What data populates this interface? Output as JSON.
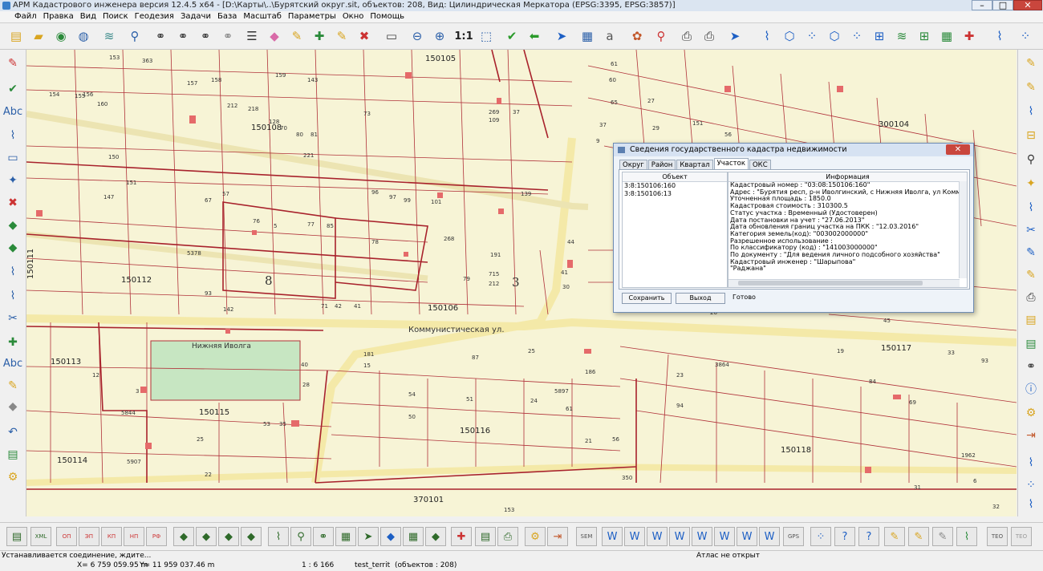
{
  "window": {
    "title": "АРМ Кадастрового инженера версия 12.4.5 x64 - [D:\\Карты\\..\\Бурятский округ.sit, объектов: 208, Вид: Цилиндрическая Меркатора (EPSG:3395, EPSG:3857)]",
    "minimize": "–",
    "maximize": "□",
    "close": "✕"
  },
  "menu": [
    "Файл",
    "Правка",
    "Вид",
    "Поиск",
    "Геодезия",
    "Задачи",
    "База",
    "Масштаб",
    "Параметры",
    "Окно",
    "Помощь"
  ],
  "toolbar": {
    "scale_label": "1:1"
  },
  "left_toolbar": {
    "abc_top": "Abc",
    "abc_bottom": "Abc"
  },
  "map": {
    "street_name": "Коммунистическая ул.",
    "lake_name": "Нижняя Иволга",
    "quarters": [
      "150105",
      "150108",
      "150112",
      "150106",
      "150111",
      "150113",
      "150115",
      "150114",
      "150116",
      "150117",
      "150118",
      "300104",
      "370101"
    ],
    "big_labels": [
      "8",
      "3"
    ],
    "parcel_labels": [
      "153",
      "363",
      "160",
      "155",
      "156",
      "157",
      "158",
      "159",
      "143",
      "154",
      "212",
      "218",
      "128",
      "70",
      "80",
      "81",
      "73",
      "269",
      "109",
      "37",
      "61",
      "60",
      "65",
      "37",
      "9",
      "150",
      "147",
      "151",
      "67",
      "57",
      "76",
      "5",
      "77",
      "85",
      "96",
      "97",
      "99",
      "101",
      "139",
      "78",
      "191",
      "715",
      "212",
      "79",
      "93",
      "142",
      "71",
      "42",
      "41",
      "181",
      "15",
      "87",
      "25",
      "186",
      "23",
      "54",
      "50",
      "51",
      "24",
      "61",
      "53",
      "35",
      "3",
      "12",
      "40",
      "28",
      "25",
      "22",
      "21",
      "56",
      "27",
      "29",
      "151",
      "56",
      "41",
      "30",
      "44",
      "26",
      "84",
      "69",
      "94",
      "19",
      "45",
      "93",
      "33",
      "31",
      "6",
      "32",
      "70"
    ],
    "road_numbers": [
      "221",
      "5378",
      "268",
      "5844",
      "5907",
      "5897",
      "3864",
      "1962"
    ],
    "bottom_labels": [
      "153",
      "350"
    ]
  },
  "dialog": {
    "title": "Сведения государственного кадастра недвижимости",
    "close": "✕",
    "tabs": [
      "Округ",
      "Район",
      "Квартал",
      "Участок",
      "ОКС"
    ],
    "active_tab": "Участок",
    "object_header": "Объект",
    "info_header": "Информация",
    "objects": [
      "3:8:150106:160",
      "3:8:150106:13"
    ],
    "info": [
      "Кадастровый номер : \"03:08:150106:160\"",
      "Адрес : \"Бурятия респ, р-н Иволгинский, с Нижняя Иволга, ул Коммунистическая",
      "Уточненная площадь : 1850.0",
      "Кадастровая стоимость : 310300.5",
      "Статус участка : Временный (Удостоверен)",
      "Дата постановки на учет : \"27.06.2013\"",
      "Дата обновления границ участка на ПКК : \"12.03.2016\"",
      "Категория земель(код): \"003002000000\"",
      "Разрешенное использование :",
      "По классификатору (код) : \"141003000000\"",
      "По документу : \"Для ведения личного подсобного хозяйства\"",
      "Кадастровый инженер : \"Шарыпова\"",
      "\"Раджана\""
    ],
    "save_button": "Сохранить",
    "exit_button": "Выход",
    "status": "Готово"
  },
  "bottom_toolbar": {
    "layer_labels": [
      "ОП",
      "ЭП",
      "КП",
      "НП",
      "РФ"
    ],
    "xml_label": "XML",
    "gps_label": "GPS",
    "sem_label": "SEM",
    "teo_label": "TEO"
  },
  "status": {
    "connection": "Устанавливается соединение, ждите...",
    "atlas": "Атлас не открыт",
    "x": "X= 6 759 059.95 m",
    "y": "Y= 11 959 037.46 m",
    "scale": "1 : 6 166",
    "layer": "test_territ",
    "objects": "(объектов : 208)"
  },
  "colors": {
    "map_bg": "#f7f4d6",
    "parcel_line": "#b0323a",
    "road": "#f4e9a8",
    "lake": "#c7e6c2",
    "dialog_bg": "#eef3f9"
  }
}
